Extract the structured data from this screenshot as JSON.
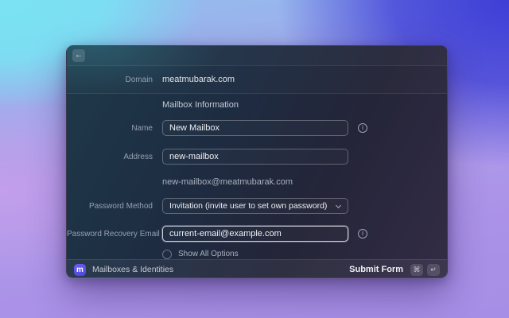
{
  "window": {
    "header": {
      "back_icon": "←"
    },
    "domain": {
      "label": "Domain",
      "value": "meatmubarak.com"
    },
    "form": {
      "section_title": "Mailbox Information",
      "name": {
        "label": "Name",
        "value": "New Mailbox"
      },
      "address": {
        "label": "Address",
        "value": "new-mailbox"
      },
      "address_preview": "new-mailbox@meatmubarak.com",
      "password_method": {
        "label": "Password Method",
        "value": "Invitation (invite user to set own password)"
      },
      "password_recovery_email": {
        "label": "Password Recovery Email",
        "value": "current-email@example.com"
      },
      "show_all_options": {
        "label": "Show All Options",
        "checked": false
      }
    },
    "footer": {
      "app_name": "Mailboxes & Identities",
      "logo_glyph": "m",
      "submit_label": "Submit Form",
      "shortcuts": [
        "⌘",
        "↵"
      ]
    }
  },
  "icons": {
    "info": "i"
  },
  "colors": {
    "logo_accent": "#5b54e8",
    "focus_border": "#eeeef8",
    "background_cyan": "#79e3f3",
    "background_indigo": "#3e3ed6",
    "background_purple": "#a68ee6"
  }
}
